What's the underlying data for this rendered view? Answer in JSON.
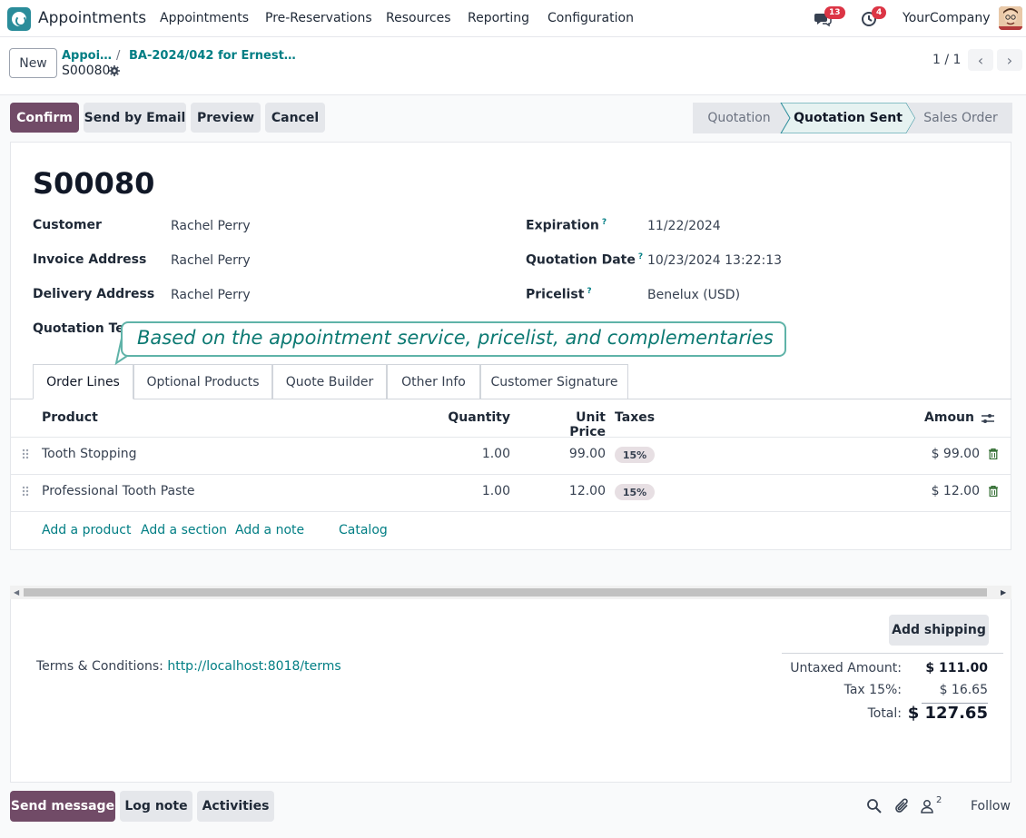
{
  "navbar": {
    "app_name": "Appointments",
    "menu": [
      "Appointments",
      "Pre-Reservations",
      "Resources",
      "Reporting",
      "Configuration"
    ],
    "messages_count": "13",
    "activities_count": "4",
    "company": "YourCompany"
  },
  "control_panel": {
    "new_label": "New",
    "breadcrumb_parent": "Appoi…",
    "breadcrumb_separator": "/",
    "breadcrumb_record": "BA-2024/042 for Ernest…",
    "current_record": "S00080",
    "pager": "1 / 1"
  },
  "actions": {
    "confirm": "Confirm",
    "send_email": "Send by Email",
    "preview": "Preview",
    "cancel": "Cancel"
  },
  "statusbar": {
    "stages": [
      "Quotation",
      "Quotation Sent",
      "Sales Order"
    ],
    "active": "Quotation Sent"
  },
  "form": {
    "title": "S00080",
    "customer_label": "Customer",
    "customer": "Rachel Perry",
    "invoice_label": "Invoice Address",
    "invoice": "Rachel Perry",
    "delivery_label": "Delivery Address",
    "delivery": "Rachel Perry",
    "quotation_template_label": "Quotation Tem",
    "expiration_label": "Expiration",
    "expiration": "11/22/2024",
    "quotation_date_label": "Quotation Date",
    "quotation_date": "10/23/2024 13:22:13",
    "pricelist_label": "Pricelist",
    "pricelist": "Benelux (USD)",
    "help_mark": "?"
  },
  "tooltip": "Based on the appointment service, pricelist, and complementaries",
  "tabs": [
    "Order Lines",
    "Optional Products",
    "Quote Builder",
    "Other Info",
    "Customer Signature"
  ],
  "order_lines": {
    "headers": {
      "product": "Product",
      "quantity": "Quantity",
      "unit_price": "Unit Price",
      "taxes": "Taxes",
      "amount": "Amoun"
    },
    "rows": [
      {
        "product": "Tooth Stopping",
        "quantity": "1.00",
        "unit_price": "99.00",
        "tax": "15%",
        "amount": "$ 99.00"
      },
      {
        "product": "Professional Tooth Paste",
        "quantity": "1.00",
        "unit_price": "12.00",
        "tax": "15%",
        "amount": "$ 12.00"
      }
    ],
    "add_product": "Add a product",
    "add_section": "Add a section",
    "add_note": "Add a note",
    "catalog": "Catalog"
  },
  "footer": {
    "add_shipping": "Add shipping",
    "terms_label": "Terms & Conditions:",
    "terms_link": "http://localhost:8018/terms",
    "untaxed_label": "Untaxed Amount:",
    "untaxed": "$ 111.00",
    "tax_label": "Tax 15%:",
    "tax": "$ 16.65",
    "total_label": "Total:",
    "total": "$ 127.65"
  },
  "chatter": {
    "send_message": "Send message",
    "log_note": "Log note",
    "activities": "Activities",
    "followers_count": "2",
    "follow": "Follow"
  },
  "colors": {
    "primary": "#714b67",
    "link": "#017e84",
    "badge": "#dc3545"
  }
}
